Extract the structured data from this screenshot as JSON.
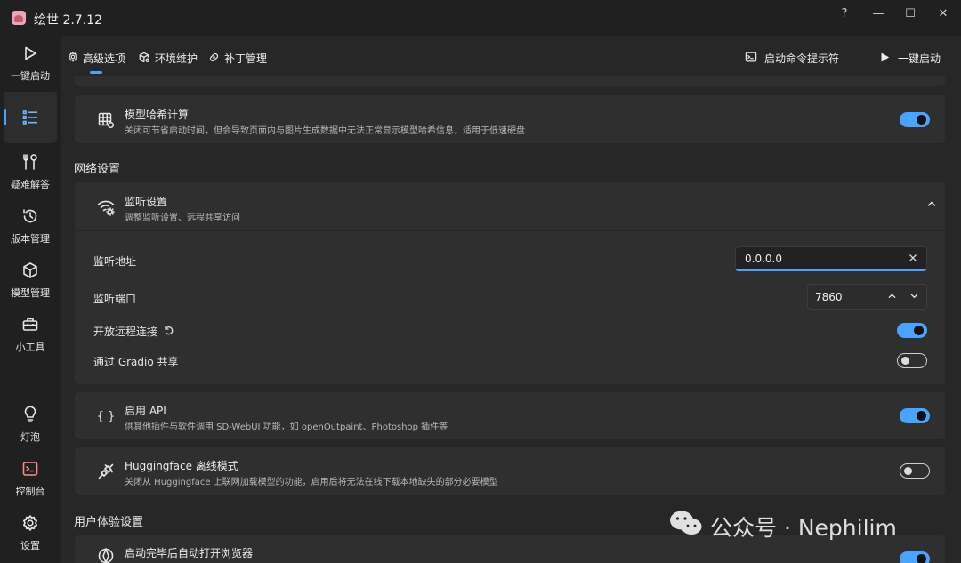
{
  "app": {
    "title": "绘世 2.7.12"
  },
  "window": {
    "help": "?",
    "minimize": "—",
    "maximize": "☐",
    "close": "✕"
  },
  "sidebar": {
    "items": [
      {
        "label": "一键启动"
      },
      {
        "label": ""
      },
      {
        "label": "疑难解答"
      },
      {
        "label": "版本管理"
      },
      {
        "label": "模型管理"
      },
      {
        "label": "小工具"
      },
      {
        "label": "灯泡"
      },
      {
        "label": "控制台"
      },
      {
        "label": "设置"
      }
    ]
  },
  "topnav": {
    "tabs": [
      {
        "label": "高级选项"
      },
      {
        "label": "环境维护"
      },
      {
        "label": "补丁管理"
      }
    ],
    "cmd_label": "启动命令提示符",
    "launch_label": "一键启动"
  },
  "hash_card": {
    "title": "模型哈希计算",
    "desc": "关闭可节省启动时间，但会导致页面内与图片生成数据中无法正常显示模型哈希信息，适用于低速硬盘",
    "enabled": true
  },
  "network": {
    "section_title": "网络设置",
    "listen": {
      "title": "监听设置",
      "desc": "调整监听设置、远程共享访问",
      "address_label": "监听地址",
      "address_value": "0.0.0.0",
      "port_label": "监听端口",
      "port_value": "7860",
      "remote_label": "开放远程连接",
      "remote_enabled": true,
      "gradio_label": "通过 Gradio 共享",
      "gradio_enabled": false
    }
  },
  "api_card": {
    "title": "启用 API",
    "desc": "供其他插件与软件调用 SD-WebUI 功能，如 openOutpaint、Photoshop 插件等",
    "icon_text": "{ }",
    "enabled": true
  },
  "hf_card": {
    "title": "Huggingface 离线模式",
    "desc": "关闭从 Huggingface 上联网加载模型的功能，启用后将无法在线下载本地缺失的部分必要模型",
    "enabled": false
  },
  "ux": {
    "section_title": "用户体验设置",
    "browser_title": "启动完毕后自动打开浏览器"
  },
  "watermark": {
    "text": "公众号 · Nephilim"
  },
  "colors": {
    "accent": "#4aa3ff",
    "background": "#202020",
    "card": "#2f2f2f"
  }
}
